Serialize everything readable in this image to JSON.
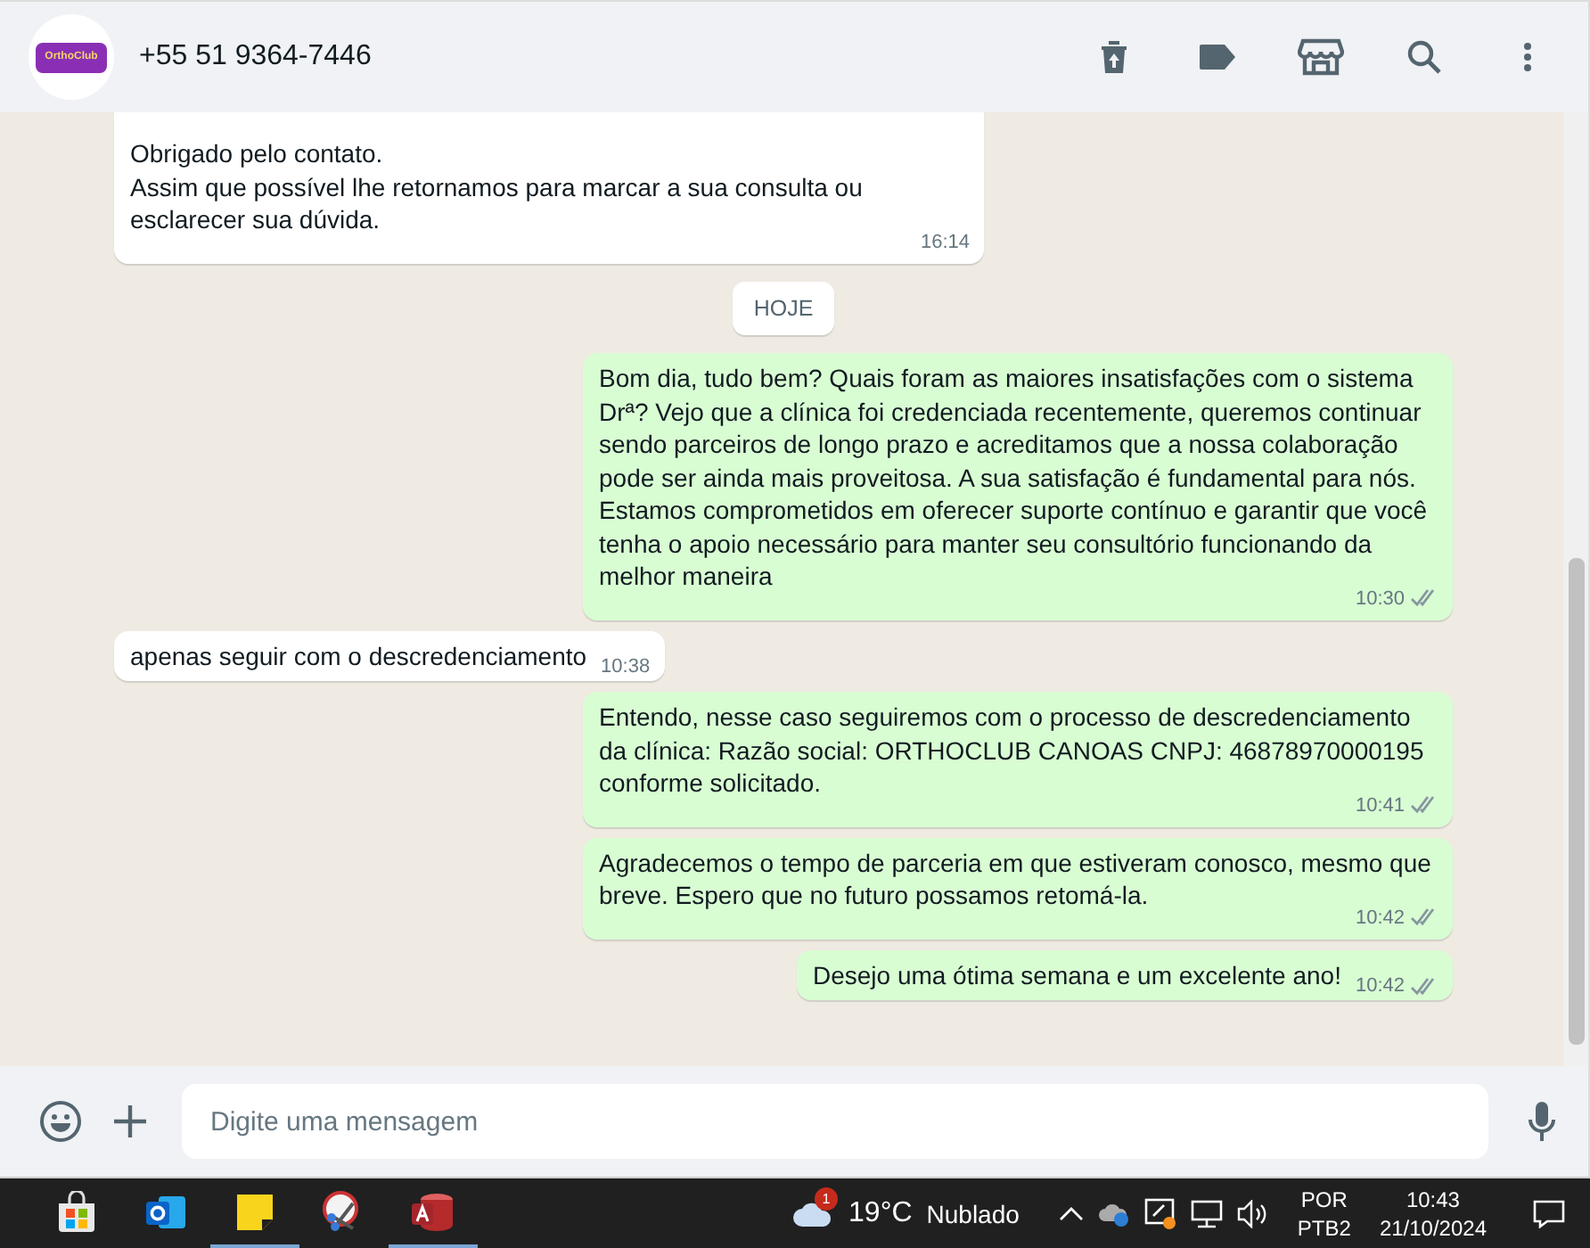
{
  "header": {
    "avatar_text": "OrthoClub",
    "contact": "+55 51 9364-7446"
  },
  "messages": [
    {
      "kind": "in",
      "lines": [
        "Obrigado pelo contato.",
        "Assim que possível lhe retornamos para marcar a sua consulta ou esclarecer sua dúvida."
      ],
      "time": "16:14",
      "cut_top": true
    },
    {
      "kind": "day",
      "lines": [
        "HOJE"
      ]
    },
    {
      "kind": "out",
      "lines": [
        "Bom dia, tudo bem? Quais foram as maiores insatisfações com o sistema Drª? Vejo que a clínica foi credenciada recentemente, queremos continuar sendo parceiros de longo prazo e acreditamos que a nossa colaboração pode ser ainda mais proveitosa. A sua satisfação é fundamental para nós. Estamos comprometidos em oferecer suporte contínuo e garantir que você tenha o apoio necessário para manter seu consultório funcionando da melhor maneira"
      ],
      "time": "10:30",
      "read": false
    },
    {
      "kind": "in",
      "lines": [
        "apenas seguir com o descredenciamento"
      ],
      "time": "10:38"
    },
    {
      "kind": "out",
      "lines": [
        "Entendo, nesse caso seguiremos com o processo de descredenciamento da clínica: Razão social: ORTHOCLUB CANOAS CNPJ: 46878970000195 conforme solicitado."
      ],
      "time": "10:41",
      "read": false
    },
    {
      "kind": "out",
      "lines": [
        "Agradecemos o tempo de parceria em que estiveram conosco, mesmo que breve. Espero que no futuro possamos retomá-la."
      ],
      "time": "10:42",
      "read": false
    },
    {
      "kind": "out",
      "lines": [
        "Desejo uma ótima semana e um excelente ano!"
      ],
      "time": "10:42",
      "read": false
    }
  ],
  "composer": {
    "placeholder": "Digite uma mensagem"
  },
  "taskbar": {
    "apps": [
      {
        "kind": "store",
        "running": false
      },
      {
        "kind": "outlook",
        "running": false
      },
      {
        "kind": "notes",
        "running": true
      },
      {
        "kind": "snip",
        "running": false
      },
      {
        "kind": "access",
        "running": true
      }
    ],
    "weather_badge": "1",
    "temperature": "19°C",
    "weather": "Nublado",
    "language": "POR",
    "layout": "PTB2",
    "time": "10:43",
    "date": "21/10/2024"
  }
}
